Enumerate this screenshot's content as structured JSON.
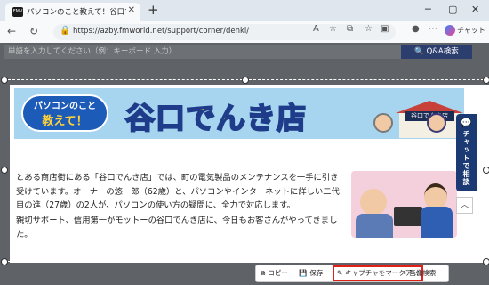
{
  "browser": {
    "tab_title": "パソコンのこと教えて！谷口でんき店 - 富",
    "tab_favicon_text": "FMV",
    "url": "https://azby.fmworld.net/support/corner/denki/",
    "chat_label": "チャット"
  },
  "site_search": {
    "placeholder": "単語を入力してください（例：キーボード 入力）",
    "button_label": "Q&A検索"
  },
  "banner": {
    "bubble_line1": "パソコンのこと",
    "bubble_line2": "教えて！",
    "title": "谷口でんき店",
    "shop_sign": "谷口でんき店"
  },
  "side_tab": {
    "label": "チャットで相談"
  },
  "article": {
    "paragraph1": "とある商店街にある「谷口でんき店」では、町の電気製品のメンテナンスを一手に引き受けています。オーナーの悠一郎（62歳）と、パソコンやインターネットに詳しい二代目の進（27歳）の2人が、パソコンの使い方の疑問に、全力で対応します。",
    "paragraph2": "親切サポート、信用第一がモットーの谷口でんき店に、今日もお客さんがやってきました。"
  },
  "capture_toolbar": {
    "copy": "コピー",
    "save": "保存",
    "markup": "キャプチャをマークア…",
    "visual_search": "画像検索"
  }
}
